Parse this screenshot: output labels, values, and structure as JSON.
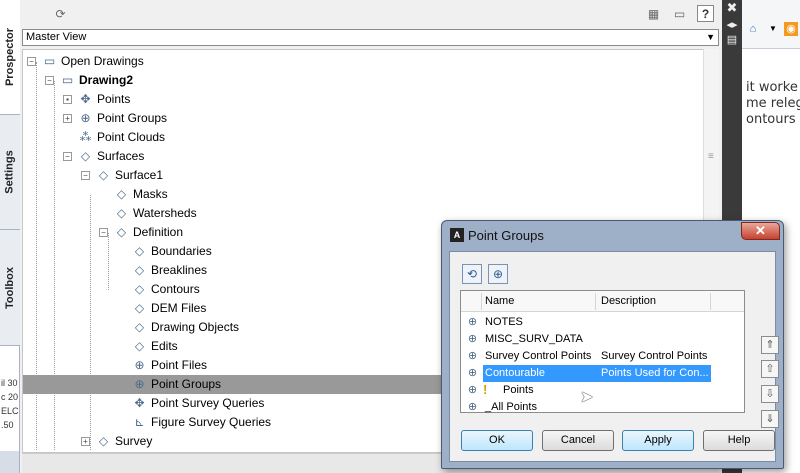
{
  "left_tabs": [
    "Prospector",
    "Settings",
    "Toolbox"
  ],
  "left_strip_text": [
    "il 30",
    "c 20",
    "ELC",
    ".50"
  ],
  "toolbar": {
    "refresh_icon": "refresh-icon",
    "help_label": "?"
  },
  "view_select": {
    "value": "Master View"
  },
  "tree": {
    "items": [
      {
        "label": "Open Drawings",
        "icon": "drawings-icon",
        "toggle": "-"
      },
      {
        "label": "Drawing2",
        "icon": "drawing-icon",
        "toggle": "-"
      },
      {
        "label": "Points",
        "icon": "points-icon",
        "toggle": "•"
      },
      {
        "label": "Point Groups",
        "icon": "point-groups-icon",
        "toggle": "+"
      },
      {
        "label": "Point Clouds",
        "icon": "point-clouds-icon",
        "toggle": ""
      },
      {
        "label": "Surfaces",
        "icon": "surfaces-icon",
        "toggle": "-"
      },
      {
        "label": "Surface1",
        "icon": "surface-icon",
        "toggle": "-"
      },
      {
        "label": "Masks",
        "icon": "masks-icon",
        "toggle": ""
      },
      {
        "label": "Watersheds",
        "icon": "watersheds-icon",
        "toggle": ""
      },
      {
        "label": "Definition",
        "icon": "definition-icon",
        "toggle": "-"
      },
      {
        "label": "Boundaries",
        "icon": "boundaries-icon",
        "toggle": ""
      },
      {
        "label": "Breaklines",
        "icon": "breaklines-icon",
        "toggle": ""
      },
      {
        "label": "Contours",
        "icon": "contours-icon",
        "toggle": ""
      },
      {
        "label": "DEM Files",
        "icon": "dem-files-icon",
        "toggle": ""
      },
      {
        "label": "Drawing Objects",
        "icon": "drawing-objects-icon",
        "toggle": ""
      },
      {
        "label": "Edits",
        "icon": "edits-icon",
        "toggle": ""
      },
      {
        "label": "Point Files",
        "icon": "point-files-icon",
        "toggle": ""
      },
      {
        "label": "Point Groups",
        "icon": "point-groups-icon",
        "toggle": ""
      },
      {
        "label": "Point Survey Queries",
        "icon": "point-survey-queries-icon",
        "toggle": ""
      },
      {
        "label": "Figure Survey Queries",
        "icon": "figure-survey-queries-icon",
        "toggle": ""
      },
      {
        "label": "Survey",
        "icon": "survey-icon",
        "toggle": "+"
      }
    ]
  },
  "browser_fragment": {
    "lines": [
      "it worke",
      "me relega",
      "ontours us"
    ]
  },
  "dialog": {
    "title": "Point Groups",
    "close_label": "✕",
    "columns": [
      "Name",
      "Description"
    ],
    "rows": [
      {
        "name": "NOTES",
        "description": ""
      },
      {
        "name": "MISC_SURV_DATA",
        "description": ""
      },
      {
        "name": "Survey Control Points",
        "description": "Survey Control Points"
      },
      {
        "name": "Contourable",
        "description": "Points Used for Con..."
      },
      {
        "name": "Points",
        "description": ""
      },
      {
        "name": "_All Points",
        "description": ""
      }
    ],
    "selected_row": "Contourable",
    "buttons": {
      "ok": "OK",
      "cancel": "Cancel",
      "apply": "Apply",
      "help": "Help"
    }
  }
}
